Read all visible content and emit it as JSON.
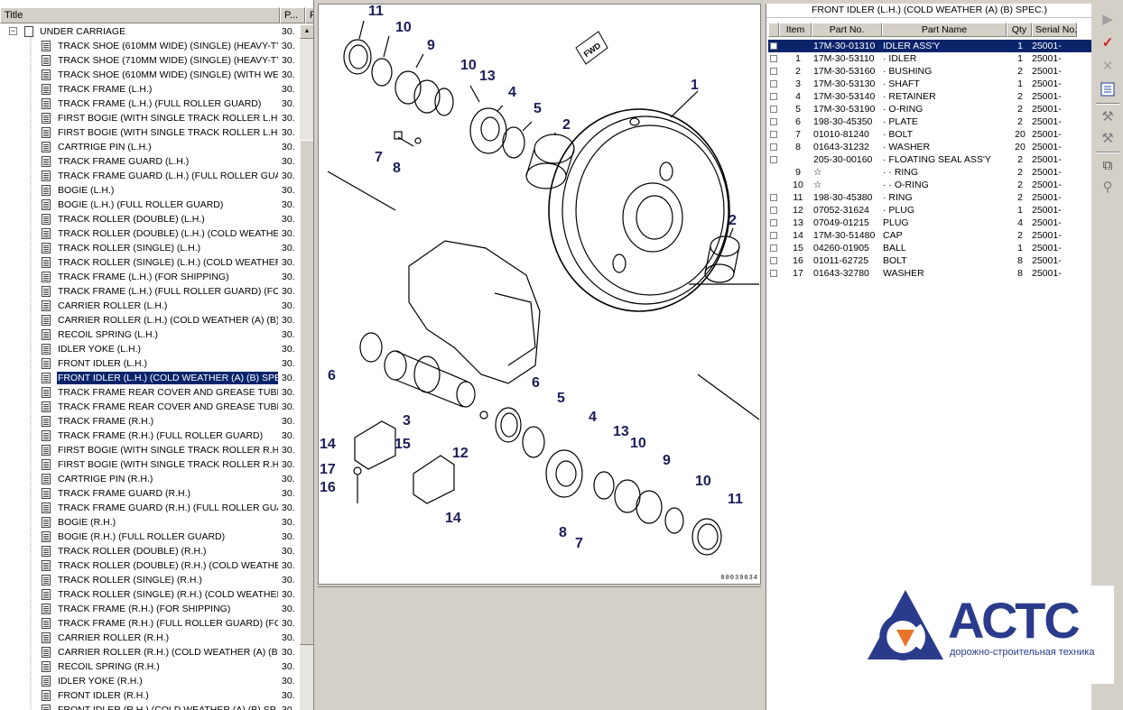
{
  "tree": {
    "header": {
      "title": "Title",
      "serial_short": "P...",
      "col3": "F"
    },
    "root": {
      "label": "UNDER CARRIAGE",
      "serial": "30."
    },
    "items": [
      {
        "label": "TRACK SHOE (610MM WIDE) (SINGLE) (HEAVY-TY...",
        "serial": "30."
      },
      {
        "label": "TRACK SHOE (710MM WIDE) (SINGLE) (HEAVY-TY...",
        "serial": "30."
      },
      {
        "label": "TRACK SHOE (610MM WIDE) (SINGLE) (WITH WE...",
        "serial": "30."
      },
      {
        "label": "TRACK FRAME (L.H.)",
        "serial": "30."
      },
      {
        "label": "TRACK FRAME (L.H.) (FULL ROLLER GUARD)",
        "serial": "30."
      },
      {
        "label": "FIRST BOGIE (WITH SINGLE TRACK ROLLER L.H.)",
        "serial": "30."
      },
      {
        "label": "FIRST BOGIE (WITH SINGLE TRACK ROLLER L.H.)...",
        "serial": "30."
      },
      {
        "label": "CARTRIGE PIN (L.H.)",
        "serial": "30."
      },
      {
        "label": "TRACK FRAME GUARD (L.H.)",
        "serial": "30."
      },
      {
        "label": "TRACK FRAME GUARD (L.H.) (FULL ROLLER GUA...",
        "serial": "30."
      },
      {
        "label": "BOGIE (L.H.)",
        "serial": "30."
      },
      {
        "label": "BOGIE (L.H.) (FULL ROLLER GUARD)",
        "serial": "30."
      },
      {
        "label": "TRACK ROLLER (DOUBLE) (L.H.)",
        "serial": "30."
      },
      {
        "label": "TRACK ROLLER (DOUBLE) (L.H.) (COLD WEATHE...",
        "serial": "30."
      },
      {
        "label": "TRACK ROLLER (SINGLE) (L.H.)",
        "serial": "30."
      },
      {
        "label": "TRACK ROLLER (SINGLE) (L.H.) (COLD WEATHER ...",
        "serial": "30."
      },
      {
        "label": "TRACK FRAME (L.H.) (FOR SHIPPING)",
        "serial": "30."
      },
      {
        "label": "TRACK FRAME (L.H.) (FULL ROLLER GUARD) (FO...",
        "serial": "30."
      },
      {
        "label": "CARRIER ROLLER (L.H.)",
        "serial": "30."
      },
      {
        "label": "CARRIER ROLLER (L.H.) (COLD WEATHER (A) (B)...",
        "serial": "30."
      },
      {
        "label": "RECOIL SPRING (L.H.)",
        "serial": "30."
      },
      {
        "label": "IDLER YOKE (L.H.)",
        "serial": "30."
      },
      {
        "label": "FRONT IDLER (L.H.)",
        "serial": "30."
      },
      {
        "label": "FRONT IDLER (L.H.) (COLD WEATHER (A) (B) SPE...",
        "serial": "30.",
        "selected": true
      },
      {
        "label": "TRACK FRAME REAR COVER AND GREASE TUBE (...",
        "serial": "30."
      },
      {
        "label": "TRACK FRAME REAR COVER AND GREASE TUBE (...",
        "serial": "30."
      },
      {
        "label": "TRACK FRAME (R.H.)",
        "serial": "30."
      },
      {
        "label": "TRACK FRAME (R.H.) (FULL ROLLER GUARD)",
        "serial": "30."
      },
      {
        "label": "FIRST BOGIE (WITH SINGLE TRACK ROLLER R.H....",
        "serial": "30."
      },
      {
        "label": "FIRST BOGIE (WITH SINGLE TRACK ROLLER R.H....",
        "serial": "30."
      },
      {
        "label": "CARTRIGE PIN (R.H.)",
        "serial": "30."
      },
      {
        "label": "TRACK FRAME GUARD (R.H.)",
        "serial": "30."
      },
      {
        "label": "TRACK FRAME GUARD (R.H.) (FULL ROLLER GUA...",
        "serial": "30."
      },
      {
        "label": "BOGIE (R.H.)",
        "serial": "30."
      },
      {
        "label": "BOGIE (R.H.) (FULL ROLLER GUARD)",
        "serial": "30."
      },
      {
        "label": "TRACK ROLLER (DOUBLE) (R.H.)",
        "serial": "30."
      },
      {
        "label": "TRACK ROLLER (DOUBLE) (R.H.) (COLD WEATHE...",
        "serial": "30."
      },
      {
        "label": "TRACK ROLLER (SINGLE) (R.H.)",
        "serial": "30."
      },
      {
        "label": "TRACK ROLLER (SINGLE) (R.H.) (COLD WEATHER...",
        "serial": "30."
      },
      {
        "label": "TRACK FRAME (R.H.) (FOR SHIPPING)",
        "serial": "30."
      },
      {
        "label": "TRACK FRAME (R.H.) (FULL ROLLER GUARD) (FO...",
        "serial": "30."
      },
      {
        "label": "CARRIER ROLLER (R.H.)",
        "serial": "30."
      },
      {
        "label": "CARRIER ROLLER (R.H.) (COLD WEATHER (A) (B)...",
        "serial": "30."
      },
      {
        "label": "RECOIL SPRING (R.H.)",
        "serial": "30."
      },
      {
        "label": "IDLER YOKE (R.H.)",
        "serial": "30."
      },
      {
        "label": "FRONT IDLER (R.H.)",
        "serial": "30."
      },
      {
        "label": "FRONT IDLER (R.H.) (COLD WEATHER (A) (B) SP...",
        "serial": "30."
      }
    ]
  },
  "diagram": {
    "fwd_label": "FWD",
    "code": "00039634",
    "callouts": [
      "11",
      "10",
      "9",
      "10",
      "13",
      "4",
      "5",
      "2",
      "1",
      "7",
      "8",
      "2",
      "6",
      "3",
      "6",
      "5",
      "4",
      "13",
      "10",
      "9",
      "10",
      "11",
      "14",
      "15",
      "12",
      "17",
      "16",
      "14",
      "8",
      "7"
    ]
  },
  "parts": {
    "title": "FRONT IDLER (L.H.) (COLD WEATHER (A) (B) SPEC.)",
    "columns": [
      "Item",
      "Part No.",
      "Part Name",
      "Qty",
      "Serial No."
    ],
    "rows": [
      {
        "item": "",
        "part_no": "17M-30-01310",
        "name": "IDLER ASS'Y",
        "qty": "1",
        "serial": "25001-",
        "selected": true,
        "checkbox": true
      },
      {
        "item": "1",
        "part_no": "17M-30-53110",
        "name": "·  IDLER",
        "qty": "1",
        "serial": "25001-",
        "checkbox": true
      },
      {
        "item": "2",
        "part_no": "17M-30-53160",
        "name": "·  BUSHING",
        "qty": "2",
        "serial": "25001-",
        "checkbox": true
      },
      {
        "item": "3",
        "part_no": "17M-30-53130",
        "name": "·  SHAFT",
        "qty": "1",
        "serial": "25001-",
        "checkbox": true
      },
      {
        "item": "4",
        "part_no": "17M-30-53140",
        "name": "·  RETAINER",
        "qty": "2",
        "serial": "25001-",
        "checkbox": true
      },
      {
        "item": "5",
        "part_no": "17M-30-53190",
        "name": "·  O-RING",
        "qty": "2",
        "serial": "25001-",
        "checkbox": true
      },
      {
        "item": "6",
        "part_no": "198-30-45350",
        "name": "·  PLATE",
        "qty": "2",
        "serial": "25001-",
        "checkbox": true
      },
      {
        "item": "7",
        "part_no": "01010-81240",
        "name": "·  BOLT",
        "qty": "20",
        "serial": "25001-",
        "checkbox": true
      },
      {
        "item": "8",
        "part_no": "01643-31232",
        "name": "·  WASHER",
        "qty": "20",
        "serial": "25001-",
        "checkbox": true
      },
      {
        "item": "",
        "part_no": "205-30-00160",
        "name": "·  FLOATING SEAL ASS'Y",
        "qty": "2",
        "serial": "25001-",
        "checkbox": true
      },
      {
        "item": "9",
        "part_no": "☆",
        "name": "·  ·  RING",
        "qty": "2",
        "serial": "25001-",
        "checkbox": false
      },
      {
        "item": "10",
        "part_no": "☆",
        "name": "·  ·  O-RING",
        "qty": "2",
        "serial": "25001-",
        "checkbox": false
      },
      {
        "item": "11",
        "part_no": "198-30-45380",
        "name": "·  RING",
        "qty": "2",
        "serial": "25001-",
        "checkbox": true
      },
      {
        "item": "12",
        "part_no": "07052-31624",
        "name": "·  PLUG",
        "qty": "1",
        "serial": "25001-",
        "checkbox": true
      },
      {
        "item": "13",
        "part_no": "07049-01215",
        "name": "PLUG",
        "qty": "4",
        "serial": "25001-",
        "checkbox": true
      },
      {
        "item": "14",
        "part_no": "17M-30-51480",
        "name": "CAP",
        "qty": "2",
        "serial": "25001-",
        "checkbox": true
      },
      {
        "item": "15",
        "part_no": "04260-01905",
        "name": "BALL",
        "qty": "1",
        "serial": "25001-",
        "checkbox": true
      },
      {
        "item": "16",
        "part_no": "01011-62725",
        "name": "BOLT",
        "qty": "8",
        "serial": "25001-",
        "checkbox": true
      },
      {
        "item": "17",
        "part_no": "01643-32780",
        "name": "WASHER",
        "qty": "8",
        "serial": "25001-",
        "checkbox": true
      }
    ]
  },
  "toolbar": {
    "buttons": [
      "play-icon",
      "checkmark-icon",
      "close-icon",
      "list-icon",
      "tools-icon",
      "tools-alt-icon",
      "binoculars-icon",
      "zoom-icon"
    ]
  },
  "logo": {
    "text": "АСТС",
    "tagline": "дорожно-строительная техника",
    "colors": {
      "brand_blue": "#2b3b8c",
      "accent_orange": "#e8742a"
    }
  },
  "colors": {
    "selection": "#0a246a",
    "face": "#d4d0c8"
  }
}
